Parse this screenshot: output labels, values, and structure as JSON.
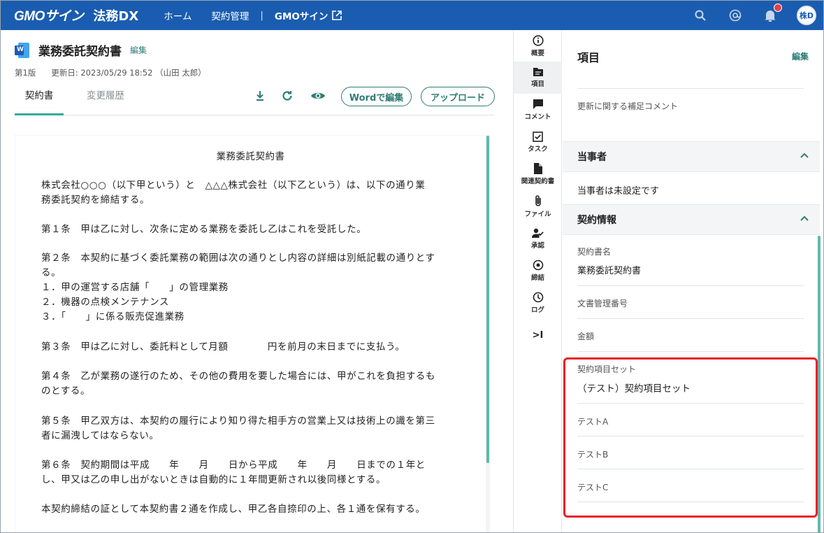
{
  "topbar": {
    "brand_main": "GMOサイン",
    "brand_sub": "法務DX",
    "nav": [
      "ホーム",
      "契約管理"
    ],
    "nav_separator": "|",
    "nav_external": "GMOサイン",
    "icons": [
      "search-icon",
      "at-icon",
      "bell-icon"
    ],
    "avatar_text": "株D",
    "accent": "#1a5db0",
    "notification_color": "#e5404a"
  },
  "document": {
    "title": "業務委託契約書",
    "edit_label": "編集",
    "version": "第1版",
    "updated": "更新日: 2023/05/29 18:52 （山田 太郎）",
    "tabs": [
      "契約書",
      "変更履歴"
    ],
    "word_button": "Wordで編集",
    "upload_button": "アップロード",
    "icon_letter": "W",
    "accent": "#2f7d75"
  },
  "contract": {
    "title": "業務委託契約書",
    "paragraphs": [
      "株式会社○○○（以下甲という）と　△△△株式会社（以下乙という）は、以下の通り業\n務委託契約を締結する。",
      "第１条　甲は乙に対し、次条に定める業務を委託し乙はこれを受託した。",
      "第２条　本契約に基づく委託業務の範囲は次の通りとし内容の詳細は別紙記載の通りとす\nる。\n１．甲の運営する店舗「　　」の管理業務\n２．機器の点検メンテナンス\n３．「　　」に係る販売促進業務",
      "第３条　甲は乙に対し、委託料として月額　　　　円を前月の末日までに支払う。",
      "第４条　乙が業務の遂行のため、その他の費用を要した場合には、甲がこれを負担するも\nのとする。",
      "第５条　甲乙双方は、本契約の履行により知り得た相手方の営業上又は技術上の識を第三\n者に漏洩してはならない。",
      "第６条　契約期間は平成　　年　　月　　日から平成　　年　　月　　日までの１年と\nし、甲又は乙の申し出がないときは自動的に１年間更新され以後同様とする。",
      "本契約締結の証として本契約書２通を作成し、甲乙各自捺印の上、各１通を保有する。"
    ]
  },
  "rail": [
    {
      "label": "概要",
      "icon": "info-icon"
    },
    {
      "label": "項目",
      "icon": "folder-icon"
    },
    {
      "label": "コメント",
      "icon": "comment-icon"
    },
    {
      "label": "タスク",
      "icon": "checkbox-icon"
    },
    {
      "label": "関連契約書",
      "icon": "document-icon"
    },
    {
      "label": "ファイル",
      "icon": "paperclip-icon"
    },
    {
      "label": "承認",
      "icon": "user-check-icon"
    },
    {
      "label": "締結",
      "icon": "target-icon"
    },
    {
      "label": "ログ",
      "icon": "clock-icon"
    },
    {
      "label": ">I",
      "icon": "collapse-icon"
    }
  ],
  "panel": {
    "title": "項目",
    "edit_label": "編集",
    "renewal_comment_label": "更新に関する補足コメント",
    "parties_section": "当事者",
    "parties_empty": "当事者は未設定です",
    "contract_info_section": "契約情報",
    "contract_name_label": "契約書名",
    "contract_name_value": "業務委託契約書",
    "doc_number_label": "文書管理番号",
    "amount_label": "金額",
    "item_set_label": "契約項目セット",
    "item_set_value": "（テスト）契約項目セット",
    "test_fields": [
      "テストA",
      "テストB",
      "テストC"
    ],
    "highlight_color": "#e8202a"
  }
}
